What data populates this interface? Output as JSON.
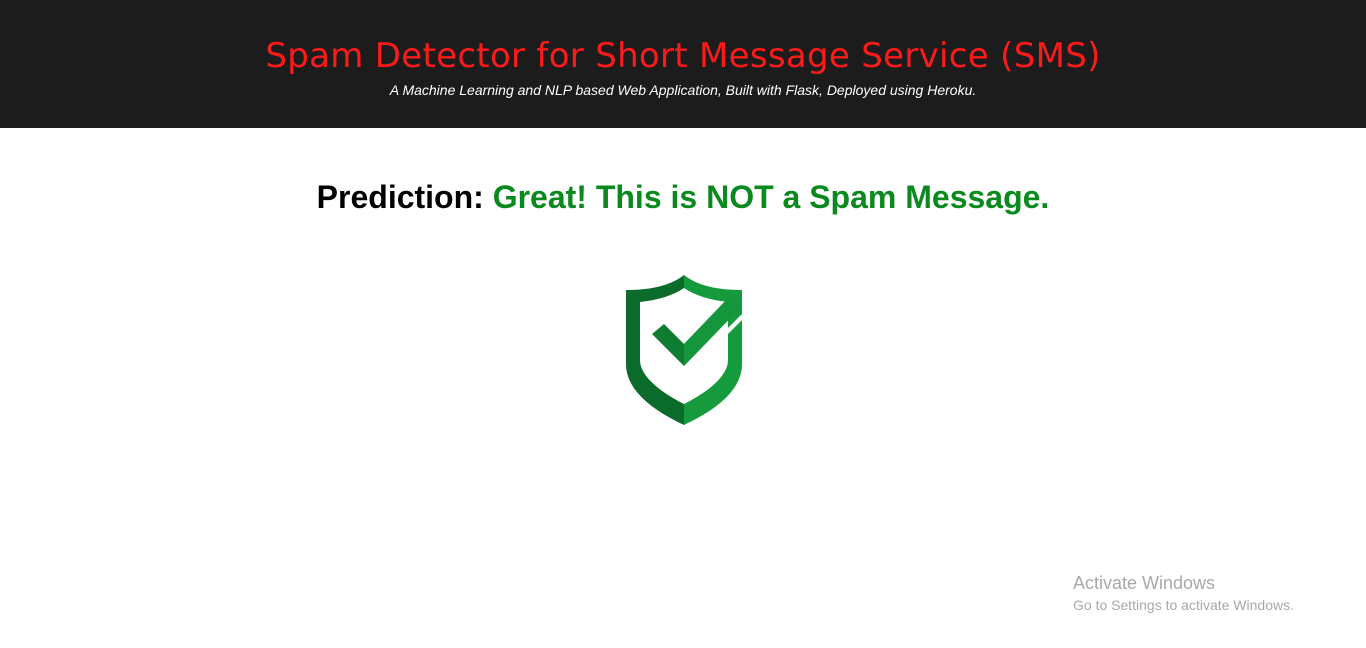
{
  "header": {
    "title": "Spam Detector for Short Message Service (SMS)",
    "subtitle": "A Machine Learning and NLP based Web Application, Built with Flask, Deployed using Heroku.",
    "background_color": "#1c1c1c",
    "title_color": "#ff1a1a"
  },
  "result": {
    "label": "Prediction:",
    "message": "Great! This is NOT a Spam Message.",
    "message_color": "#0a8a1e",
    "icon": "shield-check-icon"
  },
  "watermark": {
    "title": "Activate Windows",
    "subtitle": "Go to Settings to activate Windows."
  }
}
